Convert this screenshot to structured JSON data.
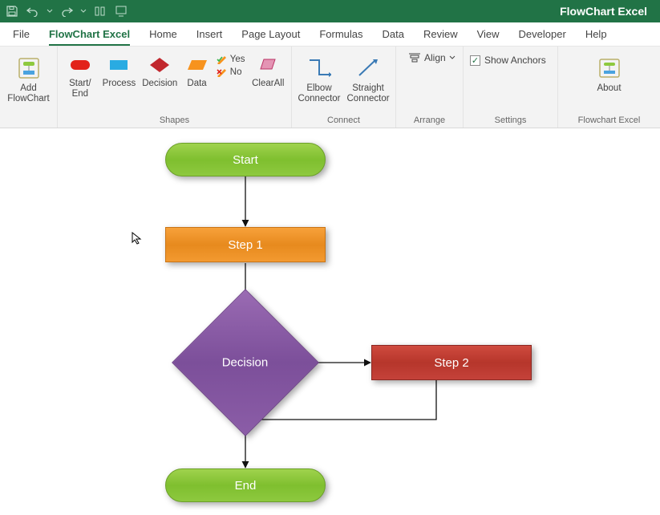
{
  "app_title": "FlowChart Excel",
  "tabs": [
    "File",
    "FlowChart Excel",
    "Home",
    "Insert",
    "Page Layout",
    "Formulas",
    "Data",
    "Review",
    "View",
    "Developer",
    "Help"
  ],
  "active_tab_index": 1,
  "ribbon": {
    "add_group": {
      "add_label": "Add FlowChart"
    },
    "shapes_group": {
      "label": "Shapes",
      "startend": "Start/ End",
      "process": "Process",
      "decision": "Decision",
      "data": "Data",
      "yes": "Yes",
      "no": "No",
      "clearall": "ClearAll"
    },
    "connect_group": {
      "label": "Connect",
      "elbow": "Elbow Connector",
      "straight": "Straight Connector"
    },
    "arrange_group": {
      "label": "Arrange",
      "align": "Align"
    },
    "settings_group": {
      "label": "Settings",
      "show_anchors": "Show Anchors",
      "checked": true
    },
    "about_group": {
      "label": "Flowchart Excel",
      "about": "About"
    }
  },
  "flowchart": {
    "nodes": {
      "start": "Start",
      "step1": "Step 1",
      "decision": "Decision",
      "step2": "Step 2",
      "end": "End"
    }
  }
}
